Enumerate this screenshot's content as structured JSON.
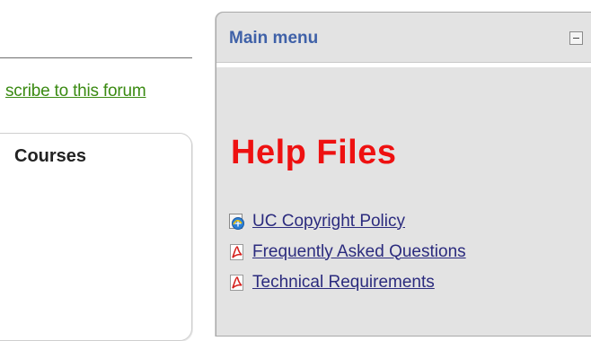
{
  "left": {
    "unsubscribe_link": "scribe to this forum",
    "courses_title": "Courses"
  },
  "main_menu": {
    "title": "Main menu",
    "collapse_icon": "minus-square-icon",
    "section_heading": "Help Files",
    "items": [
      {
        "label": "UC Copyright Policy",
        "icon": "web-link-icon"
      },
      {
        "label": "Frequently Asked Questions",
        "icon": "pdf-icon"
      },
      {
        "label": "Technical Requirements",
        "icon": "pdf-icon"
      }
    ]
  },
  "colors": {
    "menu_title": "#3f61a8",
    "help_heading": "#ee1111",
    "link": "#2b2b7e",
    "forum_link": "#3a8a12",
    "block_background": "#e3e3e3"
  }
}
